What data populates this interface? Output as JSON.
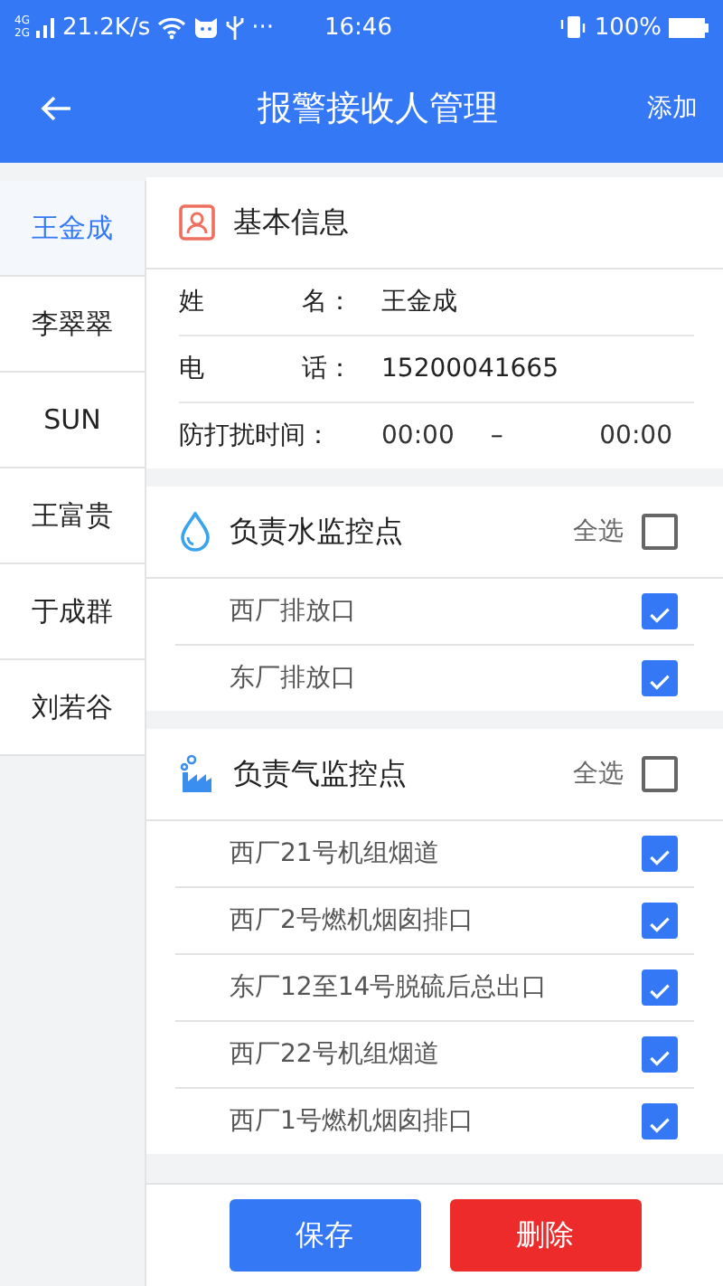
{
  "status_bar": {
    "network_types": [
      "4G",
      "2G"
    ],
    "speed": "21.2K/s",
    "more": "···",
    "time": "16:46",
    "battery": "100%"
  },
  "header": {
    "title": "报警接收人管理",
    "action": "添加"
  },
  "sidebar": {
    "items": [
      {
        "label": "王金成",
        "selected": true
      },
      {
        "label": "李翠翠",
        "selected": false
      },
      {
        "label": "SUN",
        "selected": false
      },
      {
        "label": "王富贵",
        "selected": false
      },
      {
        "label": "于成群",
        "selected": false
      },
      {
        "label": "刘若谷",
        "selected": false
      }
    ]
  },
  "basic_info": {
    "title": "基本信息",
    "name_label": [
      "姓",
      "名："
    ],
    "name": "王金成",
    "phone_label": [
      "电",
      "话："
    ],
    "phone": "15200041665",
    "dnd_label": "防打扰时间：",
    "dnd_start": "00:00",
    "dnd_sep": "–",
    "dnd_end": "00:00"
  },
  "sections": [
    {
      "kind": "water",
      "title": "负责水监控点",
      "select_all_label": "全选",
      "select_all": false,
      "items": [
        {
          "label": "西厂排放口",
          "checked": true
        },
        {
          "label": "东厂排放口",
          "checked": true
        }
      ]
    },
    {
      "kind": "air",
      "title": "负责气监控点",
      "select_all_label": "全选",
      "select_all": false,
      "items": [
        {
          "label": "西厂21号机组烟道",
          "checked": true
        },
        {
          "label": "西厂2号燃机烟囱排口",
          "checked": true
        },
        {
          "label": "东厂12至14号脱硫后总出口",
          "checked": true
        },
        {
          "label": "西厂22号机组烟道",
          "checked": true
        },
        {
          "label": "西厂1号燃机烟囱排口",
          "checked": true
        }
      ]
    }
  ],
  "buttons": [
    {
      "kind": "save",
      "label": "保存"
    },
    {
      "kind": "delete",
      "label": "删除"
    }
  ]
}
